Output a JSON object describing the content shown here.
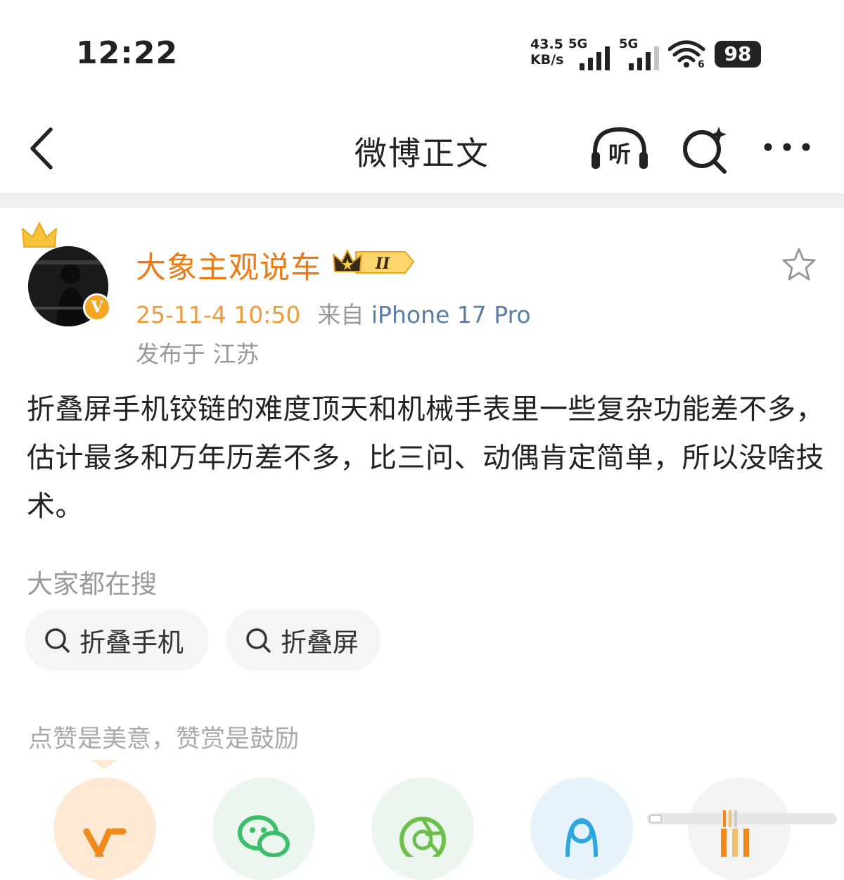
{
  "status_bar": {
    "time": "12:22",
    "net_speed_value": "43.5",
    "net_speed_unit": "KB/s",
    "signal_1_label": "5G",
    "signal_2_label": "5G",
    "wifi_sub": "6",
    "battery": "98",
    "signal_1_level": 4,
    "signal_2_level": 3
  },
  "header": {
    "title": "微博正文",
    "listen_label": "听"
  },
  "post": {
    "author": "大象主观说车",
    "vip_level": "II",
    "time": "25-11-4 10:50",
    "source_prefix": "来自",
    "source": "iPhone 17 Pro",
    "location": "发布于 江苏",
    "verified_mark": "V",
    "text": "折叠屏手机铰链的难度顶天和机械手表里一些复杂功能差不多，估计最多和万年历差不多，比三问、动偶肯定简单，所以没啥技术。"
  },
  "hot_searches": {
    "title": "大家都在搜",
    "items": [
      "折叠手机",
      "折叠屏"
    ]
  },
  "reward": {
    "title": "点赞是美意，赞赏是鼓励"
  },
  "colors": {
    "author": "#f07a12",
    "time": "#f09a3a",
    "source": "#5a7ea8",
    "muted": "#999999"
  },
  "icons": {
    "back": "chevron-left-icon",
    "listen": "headphones-icon",
    "search_ai": "search-sparkle-icon",
    "more": "more-dots-icon",
    "star": "star-outline-icon",
    "crown": "crown-icon",
    "verified": "verified-icon",
    "chip": "search-icon",
    "share": [
      "weibo-icon",
      "wechat-icon",
      "moments-icon",
      "qq-icon",
      "more-icon"
    ]
  }
}
